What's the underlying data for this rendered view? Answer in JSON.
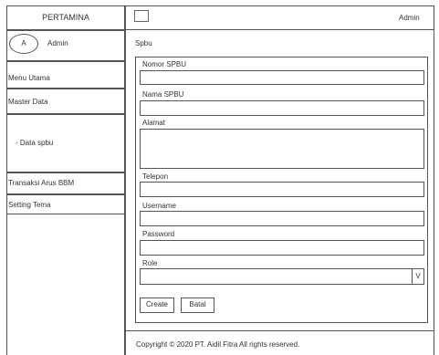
{
  "brand": "PERTAMINA",
  "header": {
    "user": "Admin"
  },
  "profile": {
    "avatar_letter": "A",
    "name": "Admin"
  },
  "sidebar": {
    "menu_utama": "Menu Utama",
    "master_data": "Master Data",
    "data_spbu": "- Data spbu",
    "transaksi": "Transaksi Arus BBM",
    "setting_tema": "Setting Tema"
  },
  "page": {
    "title": "Spbu"
  },
  "form": {
    "nomor_label": "Nomor SPBU",
    "nama_label": "Nama SPBU",
    "alamat_label": "Alamat",
    "telepon_label": "Telepon",
    "username_label": "Username",
    "password_label": "Password",
    "role_label": "Role",
    "role_arrow": "V",
    "create_label": "Create",
    "batal_label": "Batal"
  },
  "footer": {
    "copyright": "Copyright © 2020 PT. Aidil Fitra  All rights reserved."
  }
}
